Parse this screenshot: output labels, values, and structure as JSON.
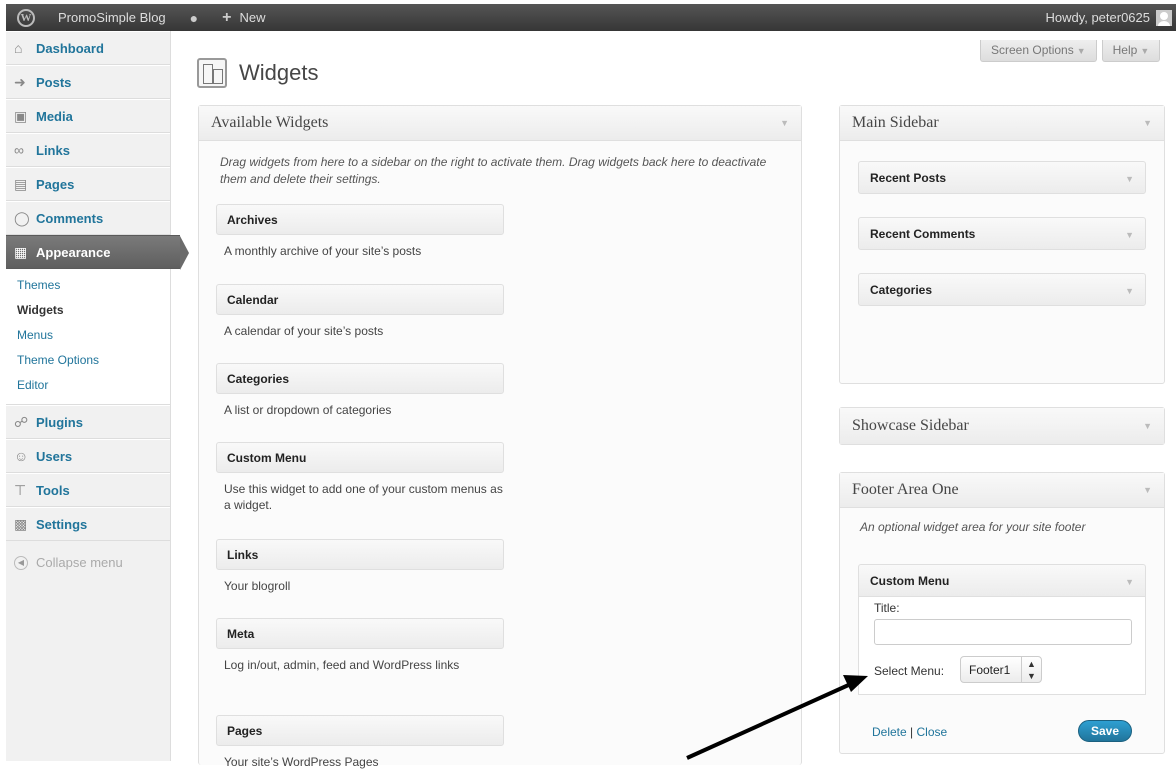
{
  "adminbar": {
    "site_name": "PromoSimple Blog",
    "new_label": "New",
    "howdy": "Howdy, peter0625"
  },
  "sidebar": {
    "items": [
      {
        "label": "Dashboard",
        "icon": "dashboard-icon"
      },
      {
        "label": "Posts",
        "icon": "pin-icon"
      },
      {
        "label": "Media",
        "icon": "media-icon"
      },
      {
        "label": "Links",
        "icon": "link-icon"
      },
      {
        "label": "Pages",
        "icon": "pages-icon"
      },
      {
        "label": "Comments",
        "icon": "comment-icon"
      },
      {
        "label": "Appearance",
        "icon": "appearance-icon"
      },
      {
        "label": "Plugins",
        "icon": "plugin-icon"
      },
      {
        "label": "Users",
        "icon": "users-icon"
      },
      {
        "label": "Tools",
        "icon": "tools-icon"
      },
      {
        "label": "Settings",
        "icon": "settings-icon"
      }
    ],
    "submenu": [
      "Themes",
      "Widgets",
      "Menus",
      "Theme Options",
      "Editor"
    ],
    "collapse": "Collapse menu"
  },
  "page": {
    "title": "Widgets",
    "screen_options": "Screen Options",
    "help": "Help"
  },
  "available": {
    "title": "Available Widgets",
    "desc": "Drag widgets from here to a sidebar on the right to activate them. Drag widgets back here to deactivate them and delete their settings.",
    "widgets": [
      {
        "name": "Archives",
        "desc": "A monthly archive of your site’s posts"
      },
      {
        "name": "Calendar",
        "desc": "A calendar of your site’s posts"
      },
      {
        "name": "Categories",
        "desc": "A list or dropdown of categories"
      },
      {
        "name": "Custom Menu",
        "desc": "Use this widget to add one of your custom menus as a widget."
      },
      {
        "name": "Links",
        "desc": "Your blogroll"
      },
      {
        "name": "Meta",
        "desc": "Log in/out, admin, feed and WordPress links"
      },
      {
        "name": "Pages",
        "desc": "Your site’s WordPress Pages"
      }
    ]
  },
  "main_sidebar": {
    "title": "Main Sidebar",
    "widgets": [
      "Recent Posts",
      "Recent Comments",
      "Categories"
    ]
  },
  "showcase_sidebar": {
    "title": "Showcase Sidebar"
  },
  "footer_one": {
    "title": "Footer Area One",
    "desc": "An optional widget area for your site footer",
    "widget_name": "Custom Menu",
    "title_label": "Title:",
    "title_value": "",
    "select_label": "Select Menu:",
    "select_value": "Footer1",
    "delete": "Delete",
    "sep": "|",
    "close": "Close",
    "save": "Save"
  }
}
